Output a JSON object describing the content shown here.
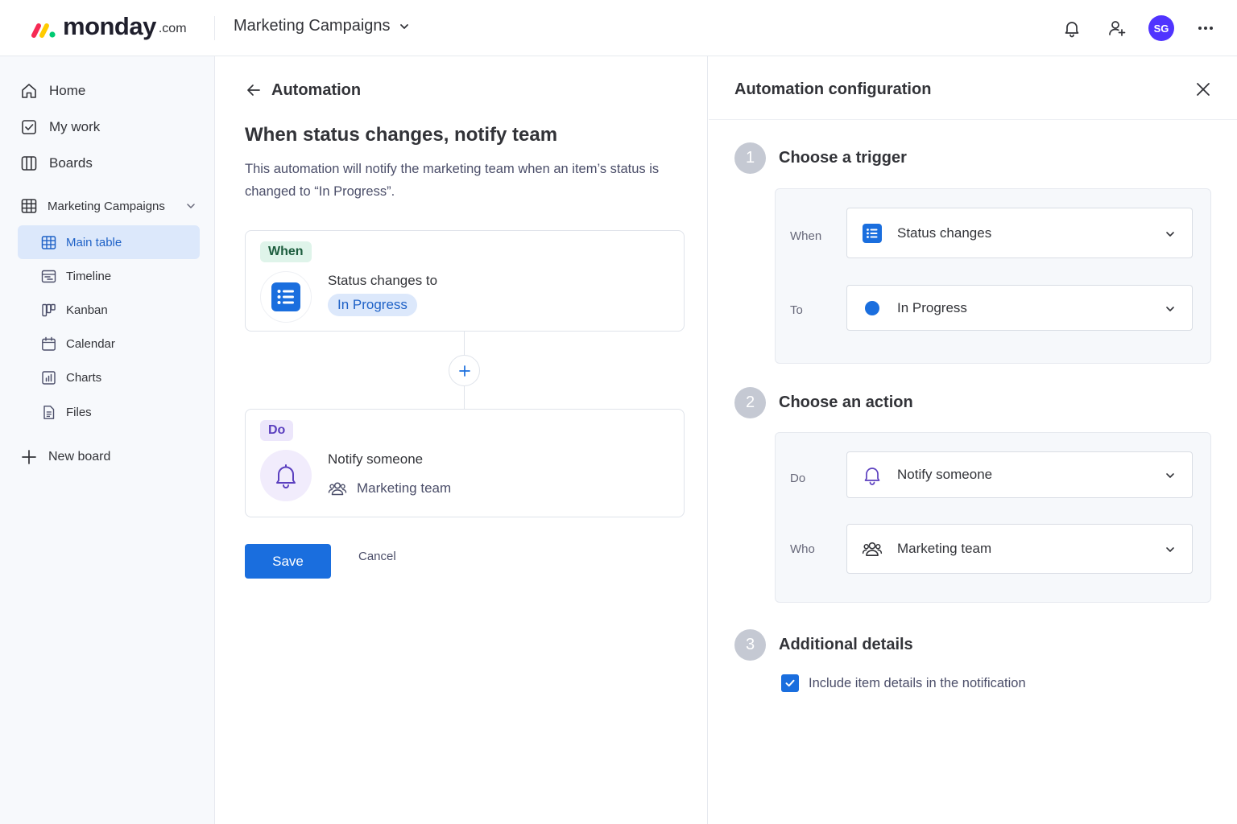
{
  "app": {
    "logo_word": "monday",
    "logo_tld": ".com",
    "brand_colors": [
      "#f62b54",
      "#ffcb00",
      "#00ca72"
    ],
    "board_switch_label": "Marketing Campaigns",
    "avatar_initials": "SG",
    "avatar_color": "#5034ff"
  },
  "sidebar": {
    "items": [
      {
        "label": "Home",
        "icon": "home-icon"
      },
      {
        "label": "My work",
        "icon": "checkbox-icon"
      },
      {
        "label": "Boards",
        "icon": "columns-icon"
      }
    ],
    "group": {
      "label": "Marketing Campaigns",
      "icon": "table-icon",
      "expanded": true
    },
    "views": [
      {
        "label": "Main table",
        "icon": "table-icon",
        "active": true
      },
      {
        "label": "Timeline",
        "icon": "timeline-icon",
        "active": false
      },
      {
        "label": "Kanban",
        "icon": "kanban-icon",
        "active": false
      },
      {
        "label": "Calendar",
        "icon": "calendar-icon",
        "active": false
      },
      {
        "label": "Charts",
        "icon": "chart-icon",
        "active": false
      },
      {
        "label": "Files",
        "icon": "file-icon",
        "active": false
      }
    ],
    "new_board_label": "New board"
  },
  "automation": {
    "header": "Automation",
    "title": "When status changes, notify team",
    "description": "This automation will notify the marketing team when an item’s status is changed to “In Progress”.",
    "when_card": {
      "pill": "When",
      "text": "Status changes to",
      "status": "In Progress"
    },
    "do_card": {
      "pill": "Do",
      "text": "Notify someone",
      "team": "Marketing team"
    },
    "save_label": "Save",
    "cancel_label": "Cancel"
  },
  "config": {
    "title": "Automation configuration",
    "steps": [
      {
        "num": "1",
        "title": "Choose a trigger",
        "fields": [
          {
            "label": "When",
            "value": "Status changes"
          },
          {
            "label": "To",
            "value": "In Progress"
          }
        ]
      },
      {
        "num": "2",
        "title": "Choose an action",
        "fields": [
          {
            "label": "Do",
            "value": "Notify someone"
          },
          {
            "label": "Who",
            "value": "Marketing team"
          }
        ]
      },
      {
        "num": "3",
        "title": "Additional details",
        "checkbox": {
          "label": "Include item details in the notification",
          "checked": true
        }
      }
    ]
  },
  "colors": {
    "accent": "#1a6ede",
    "status_in_progress": "#1a6ede",
    "when_pill_bg": "#dff4ea",
    "do_pill_bg": "#ece6fb"
  }
}
